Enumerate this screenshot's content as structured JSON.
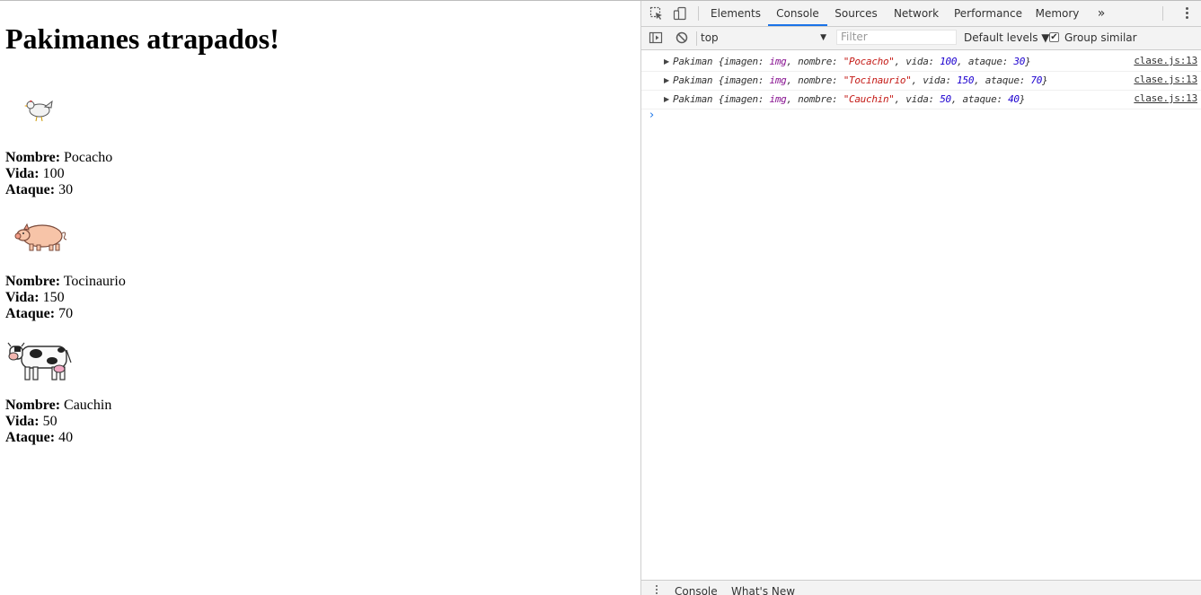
{
  "page": {
    "title": "Pakimanes atrapados!",
    "labels": {
      "nombre": "Nombre:",
      "vida": "Vida:",
      "ataque": "Ataque:"
    },
    "pakimanes": [
      {
        "nombre": "Pocacho",
        "vida": "100",
        "ataque": "30",
        "icon": "chicken-icon"
      },
      {
        "nombre": "Tocinaurio",
        "vida": "150",
        "ataque": "70",
        "icon": "pig-icon"
      },
      {
        "nombre": "Cauchin",
        "vida": "50",
        "ataque": "40",
        "icon": "cow-icon"
      }
    ]
  },
  "devtools": {
    "tabs": [
      "Elements",
      "Console",
      "Sources",
      "Network",
      "Performance",
      "Memory"
    ],
    "active_tab": "Console",
    "more_tabs": "»",
    "context": "top",
    "filter_placeholder": "Filter",
    "levels": "Default levels ▼",
    "group_similar": "Group similar",
    "group_similar_checked": true,
    "console_rows": [
      {
        "cls": "Pakiman",
        "imagen": "img",
        "nombre": "\"Pocacho\"",
        "vida": "100",
        "ataque": "30",
        "source": "clase.js:13"
      },
      {
        "cls": "Pakiman",
        "imagen": "img",
        "nombre": "\"Tocinaurio\"",
        "vida": "150",
        "ataque": "70",
        "source": "clase.js:13"
      },
      {
        "cls": "Pakiman",
        "imagen": "img",
        "nombre": "\"Cauchin\"",
        "vida": "50",
        "ataque": "40",
        "source": "clase.js:13"
      }
    ],
    "prompt": "›",
    "drawer_tabs": [
      "Console",
      "What's New"
    ]
  }
}
